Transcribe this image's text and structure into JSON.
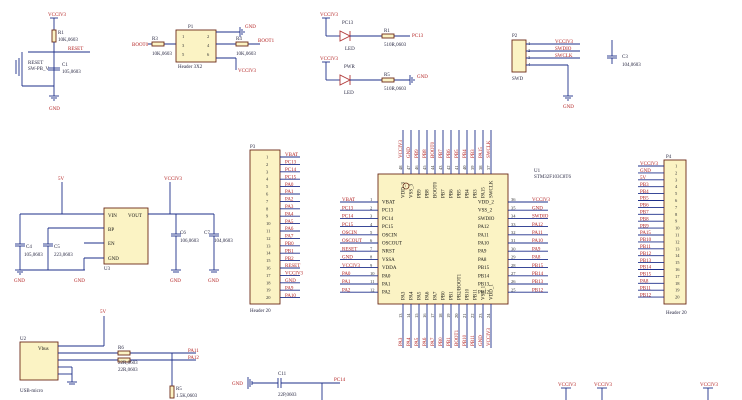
{
  "reset": {
    "r": "R1",
    "rv": "10K,0603",
    "net": "RESET",
    "sw": "RESET",
    "swv": "SW-PB_V",
    "c": "C1",
    "cv": "105,0603",
    "vcc": "VCCIV3",
    "gnd": "GND"
  },
  "boot": {
    "r3": "R3",
    "r3v": "10K,0603",
    "r4": "R4",
    "r4v": "10K,0603",
    "h": "P1",
    "hv": "Header 3X2",
    "n1": "BOOT0",
    "n2": "BOOT1",
    "vcc": "VCCIV3",
    "gnd": "GND"
  },
  "pc13": {
    "d": "PC13",
    "dv": "LED",
    "r": "R1",
    "rv": "510R,0603",
    "net": "PC13",
    "vcc": "VCCIV3"
  },
  "pwr": {
    "d": "PWR",
    "dv": "LED",
    "r": "R5",
    "rv": "510R,0603",
    "gnd": "GND",
    "vcc": "VCCIV3"
  },
  "swd": {
    "h": "P2",
    "hv": "SWD",
    "c": "C3",
    "cv": "104,0603",
    "nets": [
      "VCCIV3",
      "SWDIO",
      "SWCLK",
      "GND"
    ]
  },
  "ldo": {
    "ref": "U3",
    "pins_l": [
      "VIN",
      "BP",
      "EN",
      "GND"
    ],
    "pin_r": "VOUT",
    "vin": "5V",
    "vout": "VCCIV3",
    "c1": "C4",
    "c1v": "105,0603",
    "c2": "C5",
    "c2v": "223,0603",
    "c3": "C6",
    "c3v": "106,0603",
    "c4": "C7",
    "c4v": "104,0603",
    "gnd": "GND"
  },
  "p3": {
    "ref": "P3",
    "val": "Header 20",
    "nets": [
      "VBAT",
      "PC13",
      "PC14",
      "PC15",
      "PA0",
      "PA1",
      "PA2",
      "PA3",
      "PA4",
      "PA5",
      "PA6",
      "PA7",
      "PB0",
      "PB1",
      "PB2",
      "RESET",
      "VCCIV3",
      "GND",
      "PA9",
      "PA10"
    ]
  },
  "p4": {
    "ref": "P4",
    "val": "Header 20",
    "nets": [
      "VCCIV3",
      "GND",
      "5V",
      "PB3",
      "PB4",
      "PB5",
      "PB6",
      "PB7",
      "PB8",
      "PB9",
      "PA15",
      "PB10",
      "PB11",
      "PB12",
      "PB13",
      "PB14",
      "PB15",
      "PA8",
      "PB11",
      "PB12"
    ]
  },
  "mcu": {
    "ref": "U1",
    "val": "STM32F103C8T6",
    "left_pins": [
      [
        "1",
        "VBAT"
      ],
      [
        "2",
        "PC13"
      ],
      [
        "3",
        "PC14"
      ],
      [
        "4",
        "PC15"
      ],
      [
        "5",
        "OSCIN"
      ],
      [
        "6",
        "OSCOUT"
      ],
      [
        "7",
        "NRST"
      ],
      [
        "8",
        "VSSA"
      ],
      [
        "9",
        "VDDA"
      ],
      [
        "10",
        "PA0"
      ],
      [
        "11",
        "PA1"
      ],
      [
        "12",
        "PA2"
      ]
    ],
    "right_pins": [
      [
        "36",
        "VDD_2"
      ],
      [
        "35",
        "VSS_2"
      ],
      [
        "34",
        "SWDIO"
      ],
      [
        "33",
        "PA12"
      ],
      [
        "32",
        "PA11"
      ],
      [
        "31",
        "PA10"
      ],
      [
        "30",
        "PA9"
      ],
      [
        "29",
        "PA8"
      ],
      [
        "28",
        "PB15"
      ],
      [
        "27",
        "PB14"
      ],
      [
        "26",
        "PB13"
      ],
      [
        "25",
        "PB12"
      ]
    ],
    "top_pins": [
      [
        "48",
        "VDD_3"
      ],
      [
        "47",
        "VSS_3"
      ],
      [
        "46",
        "PB9"
      ],
      [
        "45",
        "PB8"
      ],
      [
        "44",
        "BOOT0"
      ],
      [
        "43",
        "PB7"
      ],
      [
        "42",
        "PB6"
      ],
      [
        "41",
        "PB5"
      ],
      [
        "40",
        "PB4"
      ],
      [
        "39",
        "PB3"
      ],
      [
        "38",
        "PA15"
      ],
      [
        "37",
        "SWCLK"
      ]
    ],
    "bottom_pins": [
      [
        "13",
        "PA3"
      ],
      [
        "14",
        "PA4"
      ],
      [
        "15",
        "PA5"
      ],
      [
        "16",
        "PA6"
      ],
      [
        "17",
        "PA7"
      ],
      [
        "18",
        "PB0"
      ],
      [
        "19",
        "PB1"
      ],
      [
        "20",
        "PB2/BOOT1"
      ],
      [
        "21",
        "PB10"
      ],
      [
        "22",
        "PB11"
      ],
      [
        "23",
        "VSS_1"
      ],
      [
        "24",
        "VDD_1"
      ]
    ],
    "left_nets": [
      "VBAT",
      "PC13",
      "PC14",
      "PC15",
      "OSCIN",
      "OSCOUT",
      "RESET",
      "GND",
      "VCCIV3",
      "PA0",
      "PA1",
      "PA2"
    ],
    "right_nets": [
      "VCCIV3",
      "GND",
      "SWDIO",
      "PA12",
      "PA11",
      "PA10",
      "PA9",
      "PA8",
      "PB15",
      "PB14",
      "PB13",
      "PB12"
    ],
    "top_nets": [
      "VCCIV3",
      "GND",
      "PB9",
      "PB8",
      "BOOT0",
      "PB7",
      "PB6",
      "PB5",
      "PB4",
      "PB3",
      "PA15",
      "SWCLK"
    ],
    "bottom_nets": [
      "PA3",
      "PA4",
      "PA5",
      "PA6",
      "PA7",
      "PB0",
      "PB1",
      "BOOT1",
      "PB10",
      "PB11",
      "GND",
      "VCCIV3"
    ]
  },
  "usb": {
    "ref": "U2",
    "val": "USB-micro",
    "vbus": "Vbus",
    "pin": "5V",
    "r1": "R6",
    "r1v": "22R,0603",
    "r2": "R7",
    "r2v": "22R,0603",
    "r3": "R5",
    "r3v": "1.5K,0603",
    "n1": "PA11",
    "n2": "PA12"
  },
  "osc": {
    "c": "C11",
    "cv": "22P,0603",
    "gnd": "GND",
    "net": "PC14"
  },
  "bottom_vcc": [
    "VCCIV3",
    "VCCIV3",
    "VCCIV3"
  ]
}
